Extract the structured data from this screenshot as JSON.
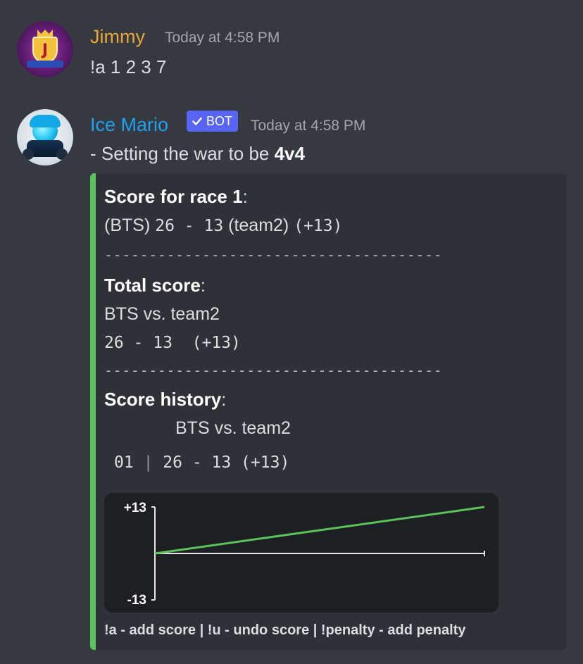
{
  "messages": [
    {
      "username": "Jimmy",
      "timestamp": "Today at 4:58 PM",
      "text": "!a 1 2 3 7",
      "username_color": "#e8a73a"
    },
    {
      "username": "Ice Mario",
      "bot_tag": "BOT",
      "timestamp": "Today at 4:58 PM",
      "text_prefix": "- Setting the war to be ",
      "text_bold": "4v4",
      "username_color": "#1da1f2"
    }
  ],
  "embed": {
    "accent_color": "#5ac35c",
    "race_heading": "Score for race 1",
    "race_line_team1": "(BTS)",
    "race_line_score": "26 - 13",
    "race_line_team2": "(team2)",
    "race_line_diff": "(+13)",
    "separator": "--------------------------------------",
    "total_heading": "Total score",
    "total_matchup": "BTS vs. team2",
    "total_line": "26 - 13  (+13)",
    "history_heading": "Score history",
    "history_matchup": "BTS vs. team2",
    "history_rows": [
      {
        "race": "01",
        "divider": "|",
        "score": "26 - 13 (+13)"
      }
    ],
    "footer": "!a - add score | !u - undo score | !penalty - add penalty"
  },
  "chart_data": {
    "type": "line",
    "x": [
      0,
      1
    ],
    "series": [
      {
        "values": [
          0,
          13
        ],
        "color": "#5ac35c"
      }
    ],
    "baseline": 0,
    "ylim": [
      -13,
      13
    ],
    "ytick_labels": [
      "+13",
      "-13"
    ]
  }
}
